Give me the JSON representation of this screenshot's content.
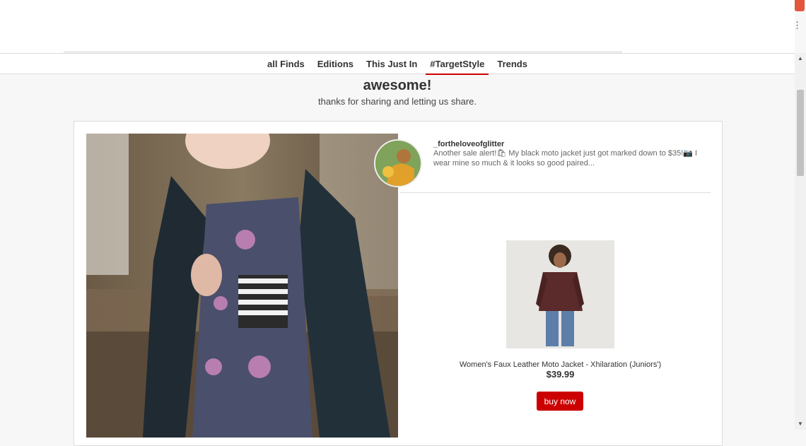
{
  "nav": {
    "items": [
      {
        "label": "all Finds"
      },
      {
        "label": "Editions"
      },
      {
        "label": "This Just In"
      },
      {
        "label": "#TargetStyle",
        "active": true
      },
      {
        "label": "Trends"
      }
    ]
  },
  "header": {
    "title": "awesome!",
    "subtitle": "thanks for sharing and letting us share."
  },
  "post": {
    "username": "_fortheloveofglitter",
    "caption": "Another sale alert!🛍 My black moto jacket just got marked down to $35!📷 I wear mine so much & it looks so good paired...",
    "photo_icon": "outfit-photo",
    "avatar_icon": "user-avatar"
  },
  "product": {
    "title": "Women's Faux Leather Moto Jacket - Xhilaration (Juniors')",
    "price": "$39.99",
    "buy_label": "buy now",
    "image_icon": "product-photo"
  },
  "colors": {
    "accent": "#cc0000",
    "background": "#f7f7f7",
    "card": "#ffffff"
  },
  "icons": {
    "menu": "more-vertical-icon",
    "scroll_up": "scroll-up-arrow",
    "scroll_down": "scroll-down-arrow"
  }
}
